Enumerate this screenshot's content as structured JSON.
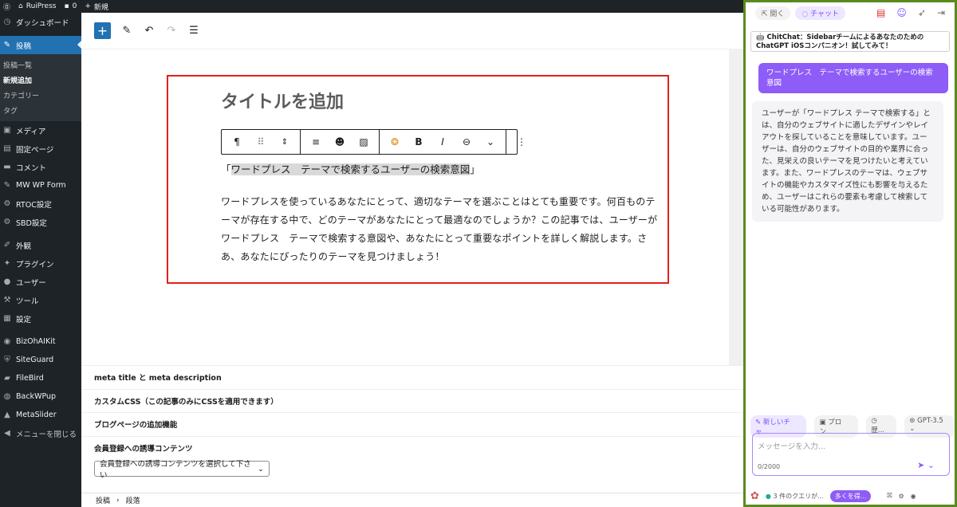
{
  "adminbar": {
    "wp_icon": "wordpress-icon",
    "site": "RuiPress",
    "comments": "0",
    "new": "新規"
  },
  "sidebar": {
    "items": [
      {
        "label": "ダッシュボード",
        "icon": "dashboard-icon"
      },
      {
        "label": "投稿",
        "icon": "pin-icon"
      },
      {
        "label": "メディア",
        "icon": "media-icon"
      },
      {
        "label": "固定ページ",
        "icon": "page-icon"
      },
      {
        "label": "コメント",
        "icon": "comment-icon"
      },
      {
        "label": "MW WP Form",
        "icon": "pin-icon"
      },
      {
        "label": "RTOC設定",
        "icon": "gear-icon"
      },
      {
        "label": "SBD設定",
        "icon": "gear-icon"
      },
      {
        "label": "外観",
        "icon": "brush-icon"
      },
      {
        "label": "プラグイン",
        "icon": "plugin-icon"
      },
      {
        "label": "ユーザー",
        "icon": "user-icon"
      },
      {
        "label": "ツール",
        "icon": "wrench-icon"
      },
      {
        "label": "設定",
        "icon": "settings-icon"
      },
      {
        "label": "BizOhAIKit",
        "icon": "plugin-icon"
      },
      {
        "label": "SiteGuard",
        "icon": "shield-icon"
      },
      {
        "label": "FileBird",
        "icon": "folder-icon"
      },
      {
        "label": "BackWPup",
        "icon": "backup-icon"
      },
      {
        "label": "MetaSlider",
        "icon": "slider-icon"
      },
      {
        "label": "メニューを閉じる",
        "icon": "collapse-icon"
      }
    ],
    "sub": [
      "投稿一覧",
      "新規追加",
      "カテゴリー",
      "タグ"
    ]
  },
  "editor": {
    "title_placeholder": "タイトルを追加",
    "heading_open": "「",
    "heading_text": "ワードプレス　テーマで検索するユーザーの検索意図",
    "heading_close": "」",
    "paragraph": "ワードプレスを使っているあなたにとって、適切なテーマを選ぶことはとても重要です。何百ものテーマが存在する中で、どのテーマがあなたにとって最適なのでしょうか？この記事では、ユーザーがワードプレス　テーマで検索する意図や、あなたにとって重要なポイントを詳しく解説します。さあ、あなたにぴったりのテーマを見つけましょう！"
  },
  "metaboxes": [
    "meta title と meta description",
    "カスタムCSS（この記事のみにCSSを適用できます）",
    "ブログページの追加機能",
    "会員登録への誘導コンテンツ"
  ],
  "select_value": "会員登録への誘導コンテンツを選択して下さい",
  "breadcrumb": {
    "first": "投稿",
    "sep": "›",
    "second": "段落"
  },
  "chit": {
    "tab_open": "開く",
    "tab_chat": "チャット",
    "banner": "🤖 ChitChat：Sidebarチームによるあなたのための ChatGPT iOSコンパニオン！試してみて！",
    "user_msg": "ワードプレス　テーマで検索するユーザーの検索意図",
    "reply": "ユーザーが「ワードプレス テーマで検索する」とは、自分のウェブサイトに適したデザインやレイアウトを探していることを意味しています。ユーザーは、自分のウェブサイトの目的や業界に合った、見栄えの良いテーマを見つけたいと考えています。また、ワードプレスのテーマは、ウェブサイトの機能やカスタマイズ性にも影響を与えるため、ユーザーはこれらの要素も考慮して検索している可能性があります。",
    "new_chat": "新しいチャ...",
    "prompt": "プロン...",
    "history": "歴...",
    "model": "GPT-3.5",
    "input_placeholder": "メッセージを入力...",
    "counter": "0/2000",
    "queries": "3 件のクエリが...",
    "more": "多くを得..."
  },
  "colors": {
    "accent": "#2271b1",
    "danger": "#e0221b",
    "chit_purple": "#8e5cf7",
    "chit_border": "#5a8a1e"
  }
}
